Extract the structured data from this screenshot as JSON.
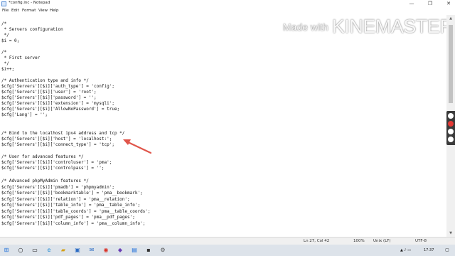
{
  "window": {
    "title": "*config.inc - Notepad",
    "minimize_glyph": "—",
    "maximize_glyph": "❐",
    "close_glyph": "✕"
  },
  "menu": [
    "File",
    "Edit",
    "Format",
    "View",
    "Help"
  ],
  "watermark": {
    "small": "Made with",
    "big": "KINEMASTER"
  },
  "code": [
    "/*",
    " * Servers configuration",
    " */",
    "$i = 0;",
    "",
    "/*",
    " * First server",
    " */",
    "$i++;",
    "",
    "/* Authentication type and info */",
    "$cfg['Servers'][$i]['auth_type'] = 'config';",
    "$cfg['Servers'][$i]['user'] = 'root';",
    "$cfg['Servers'][$i]['password'] = '';",
    "$cfg['Servers'][$i]['extension'] = 'mysqli';",
    "$cfg['Servers'][$i]['AllowNoPassword'] = true;",
    "$cfg['Lang'] = '';",
    "",
    "/* Bind to the localhost ipv4 address and tcp */",
    "$cfg['Servers'][$i]['host'] = 'localhost:';",
    "$cfg['Servers'][$i]['connect_type'] = 'tcp';",
    "",
    "/* User for advanced features */",
    "$cfg['Servers'][$i]['controluser'] = 'pma';",
    "$cfg['Servers'][$i]['controlpass'] = '';",
    "",
    "/* Advanced phpMyAdmin features */",
    "$cfg['Servers'][$i]['pmadb'] = 'phpmyadmin';",
    "$cfg['Servers'][$i]['bookmarktable'] = 'pma__bookmark';",
    "$cfg['Servers'][$i]['relation'] = 'pma__relation';",
    "$cfg['Servers'][$i]['table_info'] = 'pma__table_info';",
    "$cfg['Servers'][$i]['table_coords'] = 'pma__table_coords';",
    "$cfg['Servers'][$i]['pdf_pages'] = 'pma__pdf_pages';",
    "$cfg['Servers'][$i]['column_info'] = 'pma__column_info';"
  ],
  "status": {
    "position": "Ln 27, Col 42",
    "zoom": "100%",
    "line_ending": "Unix (LF)",
    "encoding": "UTF-8"
  },
  "taskbar": {
    "time": "17:37",
    "icons": [
      "windows-icon",
      "search-icon",
      "task-view-icon",
      "edge-icon",
      "explorer-icon",
      "store-icon",
      "mail-icon",
      "chrome-icon",
      "vscode-icon",
      "notepad-icon",
      "terminal-icon",
      "settings-icon"
    ]
  },
  "colors": {
    "annotation_arrow": "#e0554a",
    "recorder_dot": "#e53935"
  }
}
